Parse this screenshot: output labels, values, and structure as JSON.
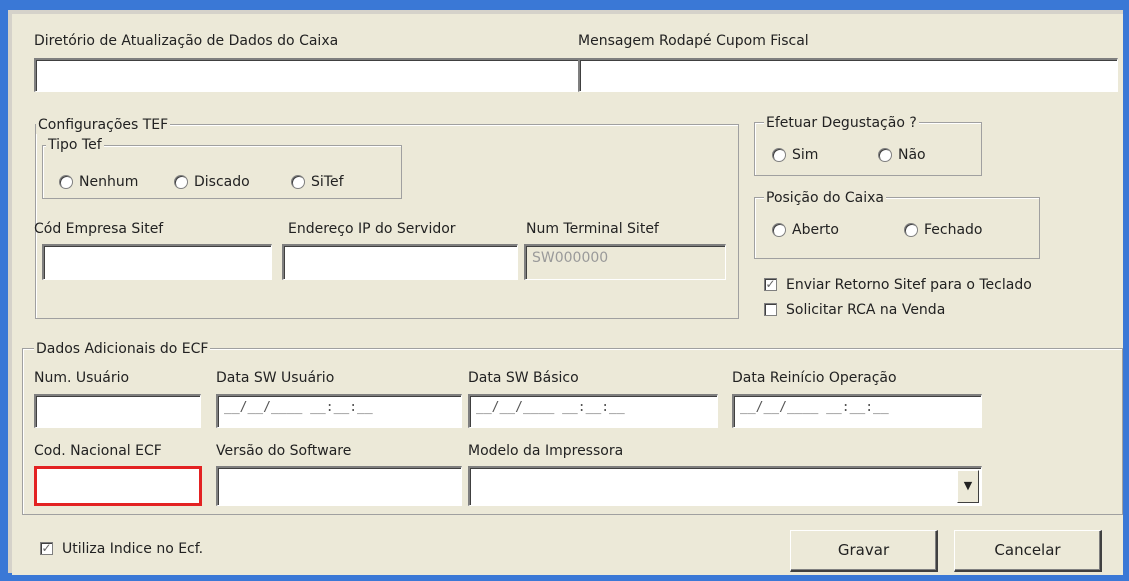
{
  "top": {
    "dir_label": "Diretório de Atualização de Dados do Caixa",
    "dir_value": "",
    "rodape_label": "Mensagem Rodapé Cupom Fiscal",
    "rodape_value": ""
  },
  "tef": {
    "group_title": "Configurações TEF",
    "tipo_title": "Tipo Tef",
    "options": [
      "Nenhum",
      "Discado",
      "SiTef"
    ],
    "cod_empresa_label": "Cód Empresa Sitef",
    "endereco_ip_label": "Endereço IP do Servidor",
    "num_terminal_label": "Num Terminal Sitef",
    "num_terminal_value": "SW000000"
  },
  "degustacao": {
    "title": "Efetuar Degustação ?",
    "options": [
      "Sim",
      "Não"
    ]
  },
  "posicao": {
    "title": "Posição do Caixa",
    "options": [
      "Aberto",
      "Fechado"
    ]
  },
  "checks": {
    "enviar_retorno": "Enviar Retorno Sitef para o Teclado",
    "enviar_retorno_checked": true,
    "solicitar_rca": "Solicitar RCA na Venda",
    "solicitar_rca_checked": false,
    "utiliza_indice": "Utiliza Indice no Ecf.",
    "utiliza_indice_checked": true
  },
  "ecf": {
    "group_title": "Dados Adicionais do ECF",
    "num_usuario_label": "Num. Usuário",
    "data_sw_usuario_label": "Data  SW Usuário",
    "data_sw_basico_label": "Data SW Básico",
    "data_reinicio_label": "Data Reinício Operação",
    "date_mask": "__/__/____ __:__:__",
    "cod_nacional_label": "Cod. Nacional ECF",
    "versao_software_label": "Versão do Software",
    "modelo_impressora_label": "Modelo da Impressora",
    "modelo_impressora_value": ""
  },
  "buttons": {
    "gravar": "Gravar",
    "cancelar": "Cancelar"
  },
  "colors": {
    "accent_frame": "#3a78d6",
    "panel_bg": "#ece9d8",
    "error_border": "#e32222"
  }
}
